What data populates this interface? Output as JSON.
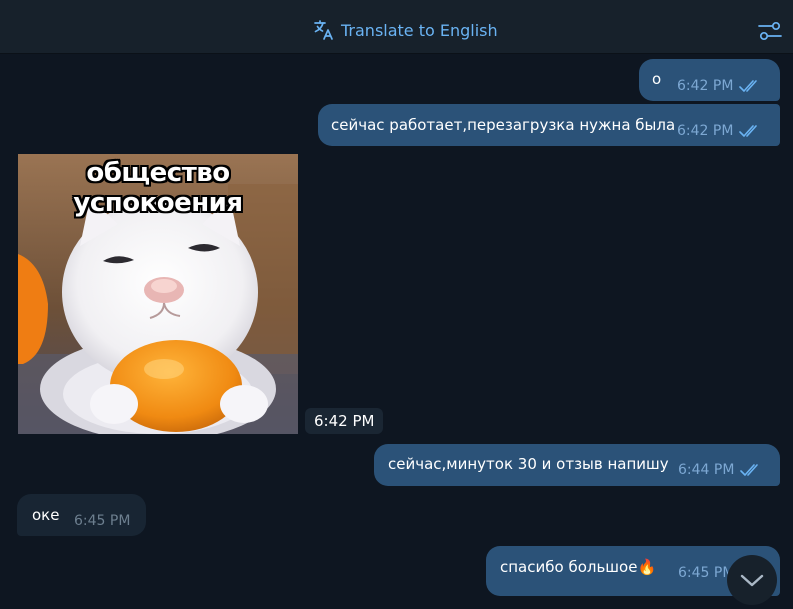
{
  "header": {
    "translate_label": "Translate to English",
    "translate_icon": "translate-icon",
    "settings_icon": "settings-sliders-icon"
  },
  "messages": [
    {
      "direction": "outgoing",
      "text": "о",
      "time": "6:42 PM",
      "status": "read"
    },
    {
      "direction": "outgoing",
      "text": "сейчас работает,перезагрузка нужна была",
      "time": "6:42 PM",
      "status": "read"
    },
    {
      "direction": "incoming",
      "type": "sticker",
      "caption": "общество успокоения",
      "time": "6:42 PM"
    },
    {
      "direction": "outgoing",
      "text": "сейчас,минуток 30 и отзыв напишу",
      "time": "6:44 PM",
      "status": "read"
    },
    {
      "direction": "incoming",
      "text": "оке",
      "time": "6:45 PM"
    },
    {
      "direction": "outgoing",
      "text": "спасибо большое",
      "emoji": "🔥",
      "time": "6:45 PM",
      "status": "read"
    }
  ],
  "scroll_down_icon": "chevron-down-icon",
  "colors": {
    "background": "#0e1621",
    "header": "#17212b",
    "outgoing_bubble": "#2b5278",
    "incoming_bubble": "#182533",
    "accent": "#6ab3f3"
  }
}
